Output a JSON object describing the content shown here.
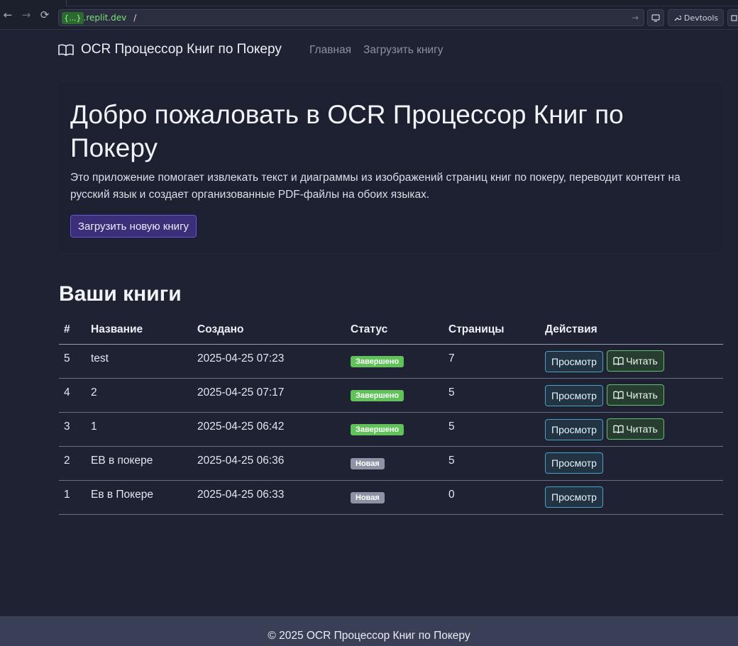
{
  "browser": {
    "url_badge": "{...}",
    "url_host": ".replit.dev",
    "url_path": "/",
    "devtools_label": "Devtools"
  },
  "navbar": {
    "brand": "OCR Процессор Книг по Покеру",
    "links": [
      "Главная",
      "Загрузить книгу"
    ]
  },
  "hero": {
    "title": "Добро пожаловать в OCR Процессор Книг по Покеру",
    "text": "Это приложение помогает извлекать текст и диаграммы из изображений страниц книг по покеру, переводит контент на русский язык и создает организованные PDF-файлы на обоих языках.",
    "button": "Загрузить новую книгу"
  },
  "books": {
    "title": "Ваши книги",
    "headers": [
      "#",
      "Название",
      "Создано",
      "Статус",
      "Страницы",
      "Действия"
    ],
    "view_label": "Просмотр",
    "read_label": "Читать",
    "rows": [
      {
        "id": "5",
        "name": "test",
        "created": "2025-04-25 07:23",
        "status": "Завершено",
        "pages": "7"
      },
      {
        "id": "4",
        "name": "2",
        "created": "2025-04-25 07:17",
        "status": "Завершено",
        "pages": "5"
      },
      {
        "id": "3",
        "name": "1",
        "created": "2025-04-25 06:42",
        "status": "Завершено",
        "pages": "5"
      },
      {
        "id": "2",
        "name": "EB в покере",
        "created": "2025-04-25 06:36",
        "status": "Новая",
        "pages": "5"
      },
      {
        "id": "1",
        "name": "Ев в Покере",
        "created": "2025-04-25 06:33",
        "status": "Новая",
        "pages": "0"
      }
    ]
  },
  "footer": {
    "text": "© 2025 OCR Процессор Книг по Покеру"
  },
  "colors": {
    "background": "#1f2233",
    "primary": "#6a55d8",
    "success": "#62c25a",
    "info": "#47a4c3",
    "secondary": "#8d92a5",
    "footer": "#3a3f58"
  }
}
